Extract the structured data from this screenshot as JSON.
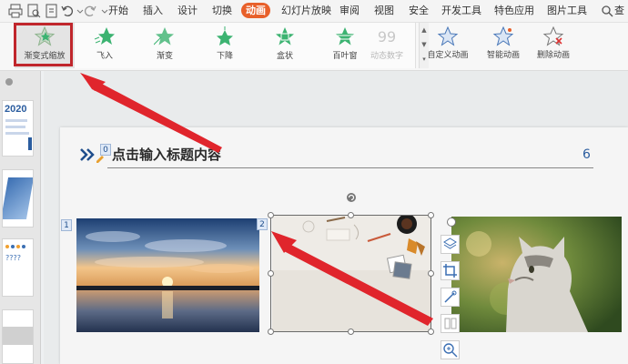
{
  "menu": {
    "tabs": [
      {
        "label": "开始"
      },
      {
        "label": "插入"
      },
      {
        "label": "设计"
      },
      {
        "label": "切换"
      },
      {
        "label": "动画"
      },
      {
        "label": "幻灯片放映"
      },
      {
        "label": "审阅"
      },
      {
        "label": "视图"
      },
      {
        "label": "安全"
      },
      {
        "label": "开发工具"
      },
      {
        "label": "特色应用"
      },
      {
        "label": "图片工具"
      },
      {
        "label": "查"
      }
    ],
    "active_tab": "动画"
  },
  "ribbon": {
    "animations": [
      {
        "label": "渐变式缩放",
        "icon": "star-fade-zoom-icon",
        "selected": true
      },
      {
        "label": "飞入",
        "icon": "star-fly-in-icon"
      },
      {
        "label": "渐变",
        "icon": "star-fade-icon"
      },
      {
        "label": "下降",
        "icon": "star-descend-icon"
      },
      {
        "label": "盒状",
        "icon": "star-box-icon"
      },
      {
        "label": "百叶窗",
        "icon": "star-blinds-icon"
      },
      {
        "label": "动态数字",
        "icon": "dynamic-number-icon",
        "disabled": true
      }
    ],
    "custom_animation": "自定义动画",
    "smart_animation": "智能动画",
    "delete_animation": "删除动画"
  },
  "thumbnails": {
    "slide_year": "2020"
  },
  "slide": {
    "title": "点击输入标题内容",
    "page_number": "6",
    "title_tag": "0",
    "picture_tags": [
      "1",
      "2"
    ]
  },
  "colors": {
    "accent": "#e8602a",
    "highlight": "#c0262c",
    "star_green": "#3cb371",
    "title_blue": "#2b5d9f"
  }
}
